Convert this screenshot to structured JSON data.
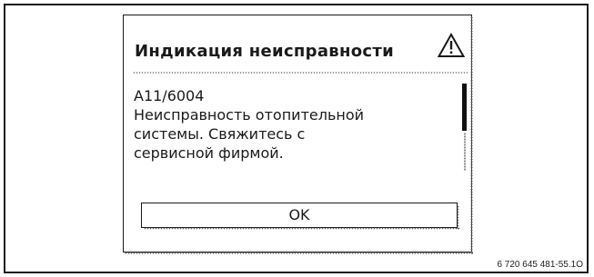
{
  "dialog": {
    "title": "Индикация неисправности",
    "icon": "warning-triangle-icon",
    "message_lines": [
      "A11/6004",
      "Неисправность отопительной",
      "системы. Свяжитесь с",
      "сервисной фирмой."
    ],
    "ok_label": "OK"
  },
  "figure": {
    "code": "6 720 645 481-55.1O"
  }
}
